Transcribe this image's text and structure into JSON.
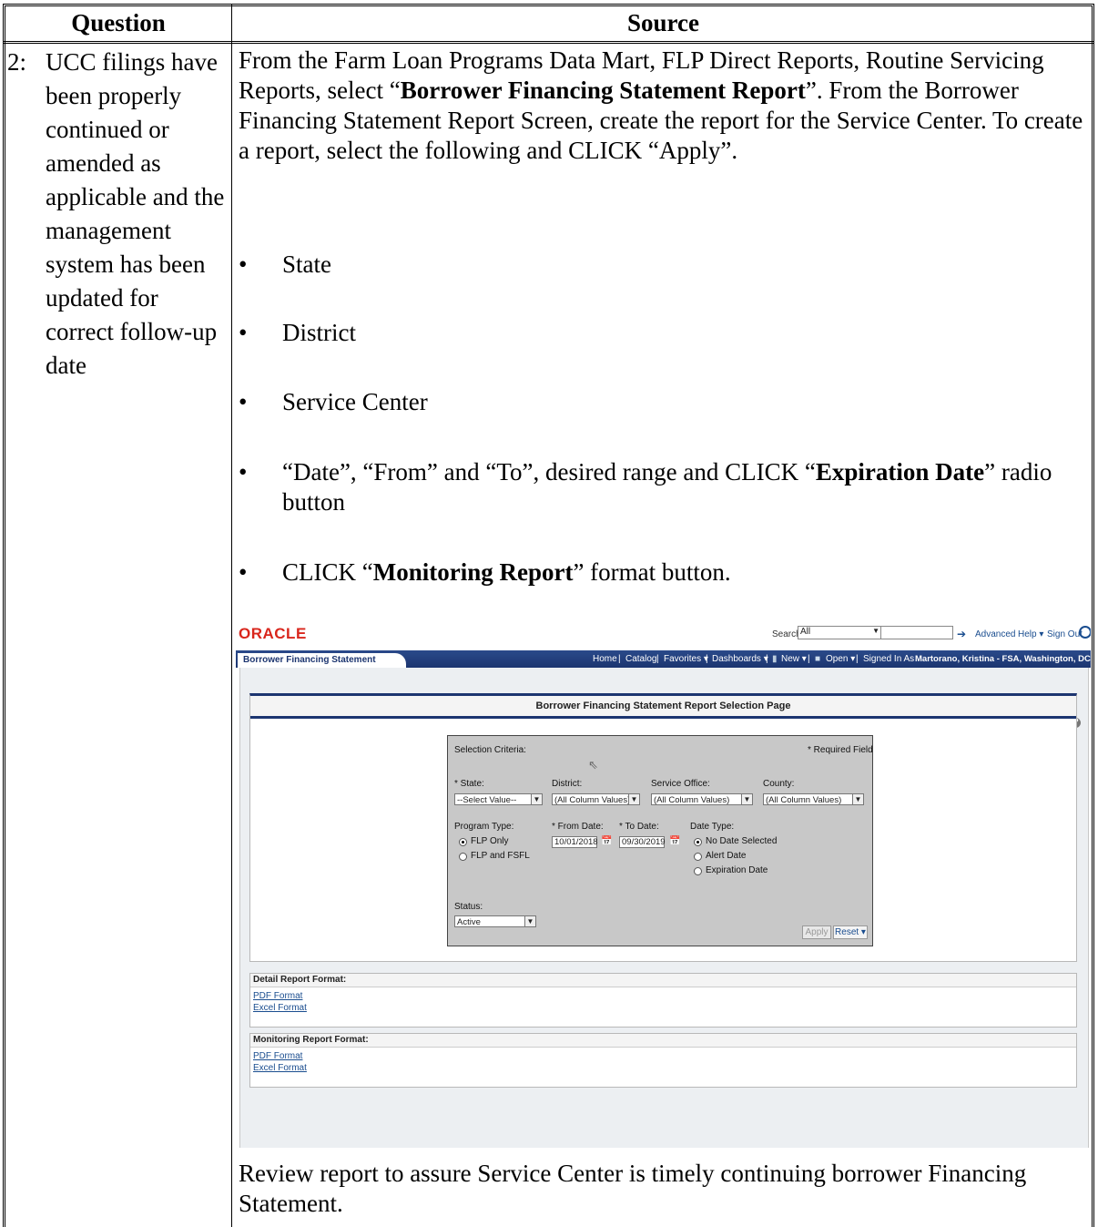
{
  "table": {
    "header_question": "Question",
    "header_source": "Source"
  },
  "question": {
    "number": "2:",
    "text": "UCC filings have been properly continued or amended as applicable and the management system has been updated for correct follow-up date"
  },
  "source": {
    "para1_a": "From the Farm Loan Programs Data Mart, FLP Direct Reports, Routine Servicing Reports, select “",
    "para1_bold": "Borrower Financing Statement Report",
    "para1_b": "”. From the Borrower Financing Statement Report Screen, create the report for the Service Center.  To create a report, select the following and CLICK “Apply”.",
    "bullets": [
      "State",
      "District",
      "Service Center"
    ],
    "bullet4_a": "“Date”, “From” and “To”, desired range and CLICK “",
    "bullet4_bold": "Expiration Date",
    "bullet4_b": "” radio button",
    "bullet5_a": "CLICK “",
    "bullet5_bold": "Monitoring Report",
    "bullet5_b": "” format button.",
    "closing": "Review report to assure Service Center is timely continuing borrower Financing Statement."
  },
  "screenshot": {
    "logo": "ORACLE",
    "search_label": "Search",
    "search_scope": "All",
    "advanced": "Advanced",
    "help": "Help ▾",
    "sign_out": "Sign Out",
    "dashboard_tab": "Borrower Financing Statement Dashboard",
    "nav": {
      "home": "Home",
      "catalog": "Catalog",
      "favorites": "Favorites ▾",
      "dashboards": "Dashboards ▾",
      "new": "New ▾",
      "open": "Open ▾",
      "signed_in_as": "Signed In As",
      "user": "Martorano, Kristina - FSA, Washington, DC ▾"
    },
    "panel_title": "Borrower Financing Statement Report Selection Page",
    "criteria": {
      "heading": "Selection Criteria:",
      "required": "* Required Field",
      "state_label": "* State:",
      "state_value": "--Select Value--",
      "district_label": "District:",
      "district_value": "(All Column Values)",
      "office_label": "Service Office:",
      "office_value": "(All Column Values)",
      "county_label": "County:",
      "county_value": "(All Column Values)",
      "program_label": "Program Type:",
      "program_opt1": "FLP Only",
      "program_opt2": "FLP and FSFL",
      "from_label": "* From Date:",
      "from_value": "10/01/2018",
      "to_label": "* To Date:",
      "to_value": "09/30/2019",
      "datetype_label": "Date Type:",
      "datetype_opt1": "No Date Selected",
      "datetype_opt2": "Alert Date",
      "datetype_opt3": "Expiration Date",
      "status_label": "Status:",
      "status_value": "Active",
      "apply": "Apply",
      "reset": "Reset ▾"
    },
    "detail_format": {
      "title": "Detail Report Format:",
      "pdf": "PDF Format",
      "excel": "Excel Format"
    },
    "monitoring_format": {
      "title": "Monitoring Report Format:",
      "pdf": "PDF Format",
      "excel": "Excel Format"
    }
  }
}
